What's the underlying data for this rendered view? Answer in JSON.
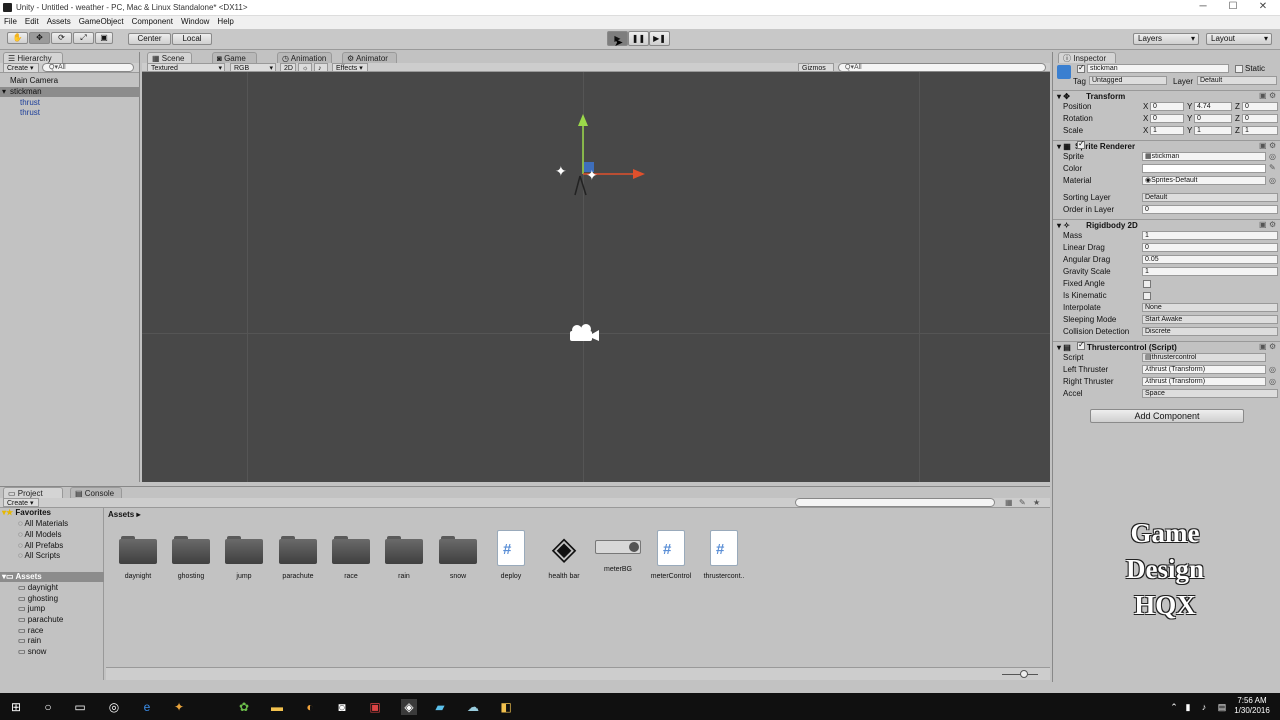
{
  "window": {
    "title": "Unity - Untitled - weather - PC, Mac & Linux Standalone* <DX11>"
  },
  "menu": [
    "File",
    "Edit",
    "Assets",
    "GameObject",
    "Component",
    "Window",
    "Help"
  ],
  "toolbar": {
    "center_label": "Center",
    "local_label": "Local",
    "layers_label": "Layers",
    "layout_label": "Layout"
  },
  "hierarchy": {
    "tab": "Hierarchy",
    "create": "Create",
    "search_placeholder": "Q▾All",
    "items": [
      {
        "label": "Main Camera"
      },
      {
        "label": "stickman"
      },
      {
        "label": "thrust"
      },
      {
        "label": "thrust"
      }
    ]
  },
  "scene": {
    "tabs": [
      "Scene",
      "Game",
      "Animation",
      "Animator"
    ],
    "shading": "Textured",
    "render": "RGB",
    "mode2d": "2D",
    "effects": "Effects",
    "gizmos": "Gizmos",
    "search_placeholder": "Q▾All"
  },
  "inspector": {
    "tab": "Inspector",
    "object_name": "stickman",
    "static_label": "Static",
    "tag_label": "Tag",
    "tag_value": "Untagged",
    "layer_label": "Layer",
    "layer_value": "Default",
    "transform": {
      "title": "Transform",
      "rows": [
        {
          "label": "Position",
          "x": "0",
          "y": "4.74",
          "z": "0"
        },
        {
          "label": "Rotation",
          "x": "0",
          "y": "0",
          "z": "0"
        },
        {
          "label": "Scale",
          "x": "1",
          "y": "1",
          "z": "1"
        }
      ]
    },
    "sprite_renderer": {
      "title": "Sprite Renderer",
      "sprite_label": "Sprite",
      "sprite_value": "stickman",
      "color_label": "Color",
      "material_label": "Material",
      "material_value": "Sprites-Default",
      "sorting_label": "Sorting Layer",
      "sorting_value": "Default",
      "order_label": "Order in Layer",
      "order_value": "0"
    },
    "rigidbody": {
      "title": "Rigidbody 2D",
      "rows": [
        {
          "label": "Mass",
          "value": "1"
        },
        {
          "label": "Linear Drag",
          "value": "0"
        },
        {
          "label": "Angular Drag",
          "value": "0.05"
        },
        {
          "label": "Gravity Scale",
          "value": "1"
        }
      ],
      "fixed_angle_label": "Fixed Angle",
      "kinematic_label": "Is Kinematic",
      "interpolate_label": "Interpolate",
      "interpolate_value": "None",
      "sleeping_label": "Sleeping Mode",
      "sleeping_value": "Start Awake",
      "collision_label": "Collision Detection",
      "collision_value": "Discrete"
    },
    "script": {
      "title": "Thrustercontrol (Script)",
      "script_label": "Script",
      "script_value": "thrustercontrol",
      "left_label": "Left Thruster",
      "left_value": "thrust (Transform)",
      "right_label": "Right Thruster",
      "right_value": "thrust (Transform)",
      "accel_label": "Accel",
      "accel_value": "Space"
    },
    "add_component": "Add Component"
  },
  "project": {
    "tabs": [
      "Project",
      "Console"
    ],
    "create": "Create",
    "breadcrumb": "Assets ▸",
    "favorites_title": "Favorites",
    "favorites": [
      "All Materials",
      "All Models",
      "All Prefabs",
      "All Scripts"
    ],
    "assets_title": "Assets",
    "tree": [
      "daynight",
      "ghosting",
      "jump",
      "parachute",
      "race",
      "rain",
      "snow"
    ],
    "assets": [
      {
        "label": "daynight",
        "kind": "folder"
      },
      {
        "label": "ghosting",
        "kind": "folder"
      },
      {
        "label": "jump",
        "kind": "folder"
      },
      {
        "label": "parachute",
        "kind": "folder"
      },
      {
        "label": "race",
        "kind": "folder"
      },
      {
        "label": "rain",
        "kind": "folder"
      },
      {
        "label": "snow",
        "kind": "folder"
      },
      {
        "label": "deploy",
        "kind": "script"
      },
      {
        "label": "health bar",
        "kind": "unity"
      },
      {
        "label": "meterBG",
        "kind": "sprite"
      },
      {
        "label": "meterControl",
        "kind": "script"
      },
      {
        "label": "thrustercont..",
        "kind": "script"
      }
    ]
  },
  "watermark": [
    "Game",
    "Design",
    "HQX"
  ],
  "taskbar": {
    "time": "7:56 AM",
    "date": "1/30/2016"
  }
}
